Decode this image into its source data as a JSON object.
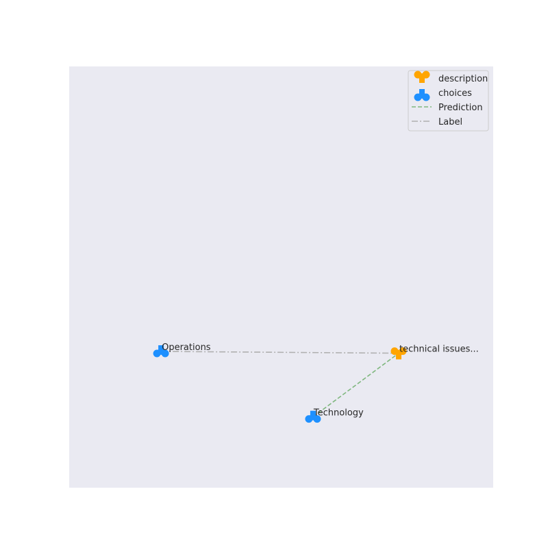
{
  "chart_data": {
    "type": "scatter",
    "title": "",
    "xlabel": "",
    "ylabel": "",
    "grid": false,
    "legend_position": "top-right",
    "colors": {
      "background": "#eaeaf2",
      "description": "#ffa500",
      "choices": "#1e90ff",
      "prediction": "#7fb77e",
      "label": "#b0b0b0"
    },
    "legend": [
      {
        "key": "description",
        "text": "description",
        "kind": "marker-down"
      },
      {
        "key": "choices",
        "text": "choices",
        "kind": "marker-up"
      },
      {
        "key": "prediction",
        "text": "Prediction",
        "kind": "dashed-line"
      },
      {
        "key": "label",
        "text": "Label",
        "kind": "dashdot-line"
      }
    ],
    "points": [
      {
        "id": "p-description",
        "series": "description",
        "text": "technical issues...",
        "x": 0.565,
        "y": -0.02
      },
      {
        "id": "p-operations",
        "series": "choices",
        "text": "Operations",
        "x": -0.78,
        "y": -0.01
      },
      {
        "id": "p-technology",
        "series": "choices",
        "text": "Technology",
        "x": 0.08,
        "y": -0.38
      }
    ],
    "links": [
      {
        "kind": "label",
        "from": "p-operations",
        "to": "p-description"
      },
      {
        "kind": "prediction",
        "from": "p-technology",
        "to": "p-description"
      }
    ],
    "xlim": [
      -1.3,
      1.1
    ],
    "ylim": [
      -0.78,
      1.6
    ]
  }
}
